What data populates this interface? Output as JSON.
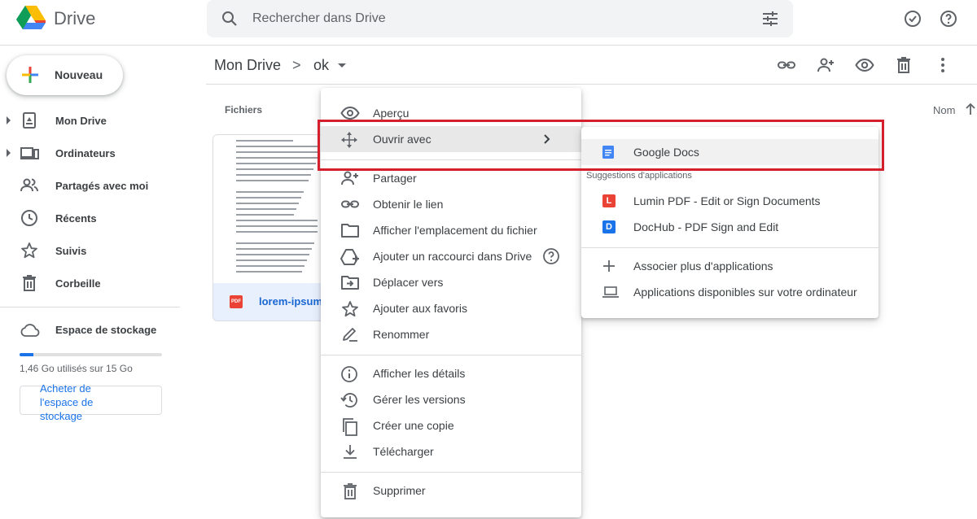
{
  "app": {
    "name": "Drive"
  },
  "search": {
    "placeholder": "Rechercher dans Drive"
  },
  "sidebar": {
    "new_label": "Nouveau",
    "items": [
      {
        "label": "Mon Drive",
        "icon": "my-drive-icon",
        "expandable": true
      },
      {
        "label": "Ordinateurs",
        "icon": "computers-icon",
        "expandable": true
      },
      {
        "label": "Partagés avec moi",
        "icon": "shared-icon",
        "expandable": false
      },
      {
        "label": "Récents",
        "icon": "clock-icon",
        "expandable": false
      },
      {
        "label": "Suivis",
        "icon": "star-icon",
        "expandable": false
      },
      {
        "label": "Corbeille",
        "icon": "trash-icon",
        "expandable": false
      }
    ],
    "storage": {
      "label": "Espace de stockage",
      "usage_text": "1,46 Go utilisés sur 15 Go",
      "used_fraction": 0.097,
      "buy_label": "Acheter de l'espace de stockage"
    }
  },
  "breadcrumb": {
    "root": "Mon Drive",
    "separator": ">",
    "current": "ok"
  },
  "main": {
    "files_label": "Fichiers",
    "sort_label": "Nom",
    "file": {
      "name": "lorem-ipsum.",
      "type_badge": "PDF"
    }
  },
  "context_menu": {
    "items": [
      {
        "label": "Aperçu",
        "icon": "eye-icon"
      },
      {
        "label": "Ouvrir avec",
        "icon": "move-icon",
        "submenu": true,
        "active": true
      },
      {
        "label": "Partager",
        "icon": "person-add-icon"
      },
      {
        "label": "Obtenir le lien",
        "icon": "link-icon"
      },
      {
        "label": "Afficher l'emplacement du fichier",
        "icon": "folder-icon"
      },
      {
        "label": "Ajouter un raccourci dans Drive",
        "icon": "shortcut-icon",
        "help": true
      },
      {
        "label": "Déplacer vers",
        "icon": "move-to-icon"
      },
      {
        "label": "Ajouter aux favoris",
        "icon": "star-icon"
      },
      {
        "label": "Renommer",
        "icon": "rename-icon"
      },
      {
        "label": "Afficher les détails",
        "icon": "info-icon"
      },
      {
        "label": "Gérer les versions",
        "icon": "history-icon"
      },
      {
        "label": "Créer une copie",
        "icon": "copy-icon"
      },
      {
        "label": "Télécharger",
        "icon": "download-icon"
      },
      {
        "label": "Supprimer",
        "icon": "trash-icon"
      }
    ]
  },
  "submenu": {
    "google_docs": "Google Docs",
    "section_label": "Suggestions d'applications",
    "apps": [
      {
        "label": "Lumin PDF - Edit or Sign Documents",
        "badge": "L",
        "color": "#ea4335"
      },
      {
        "label": "DocHub - PDF Sign and Edit",
        "badge": "D",
        "color": "#1a73e8"
      }
    ],
    "connect_more": "Associer plus d'applications",
    "desktop_apps": "Applications disponibles sur votre ordinateur"
  },
  "colors": {
    "accent": "#1a73e8",
    "highlight_frame": "#d4202c"
  }
}
